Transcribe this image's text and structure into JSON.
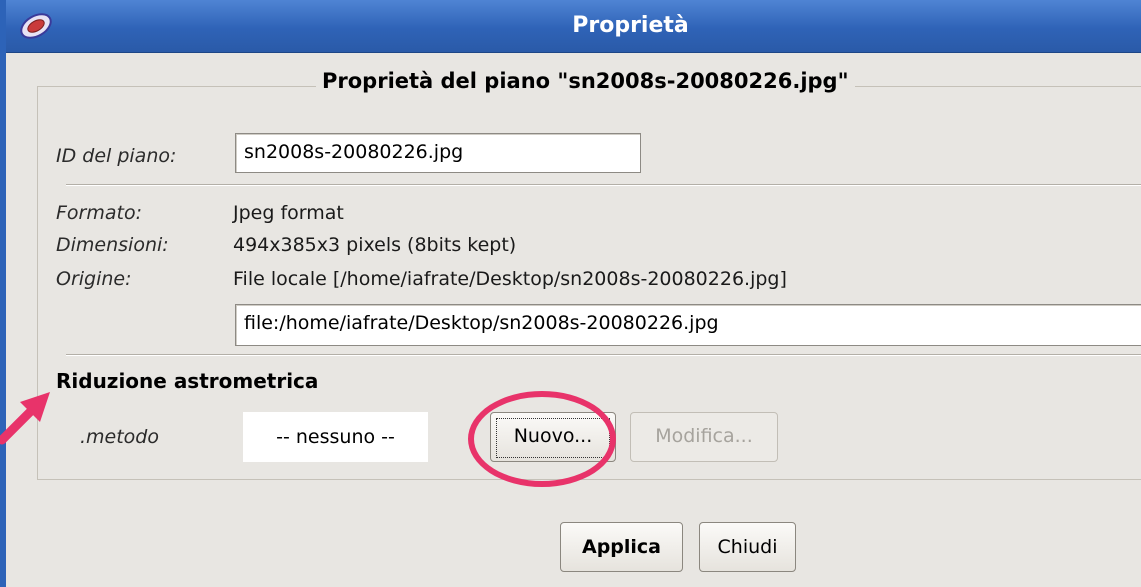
{
  "window": {
    "title": "Proprietà"
  },
  "group": {
    "legend": "Proprietà del piano \"sn2008s-20080226.jpg\""
  },
  "fields": {
    "id_label": "ID del piano:",
    "id_value": "sn2008s-20080226.jpg",
    "format_label": "Formato:",
    "format_value": "Jpeg format",
    "dimensions_label": "Dimensioni:",
    "dimensions_value": "494x385x3 pixels (8bits kept)",
    "origin_label": "Origine:",
    "origin_value": "File locale [/home/iafrate/Desktop/sn2008s-20080226.jpg]",
    "url_value": "file:/home/iafrate/Desktop/sn2008s-20080226.jpg"
  },
  "astrometry": {
    "heading": "Riduzione astrometrica",
    "method_label": ".metodo",
    "method_value": "-- nessuno --",
    "new_button": "Nuovo...",
    "edit_button": "Modifica..."
  },
  "footer": {
    "apply_button": "Applica",
    "close_button": "Chiudi"
  },
  "colors": {
    "titlebar": "#2f63b7",
    "annotation": "#e8336a"
  },
  "icons": [
    "app-icon",
    "annotation-arrow"
  ]
}
